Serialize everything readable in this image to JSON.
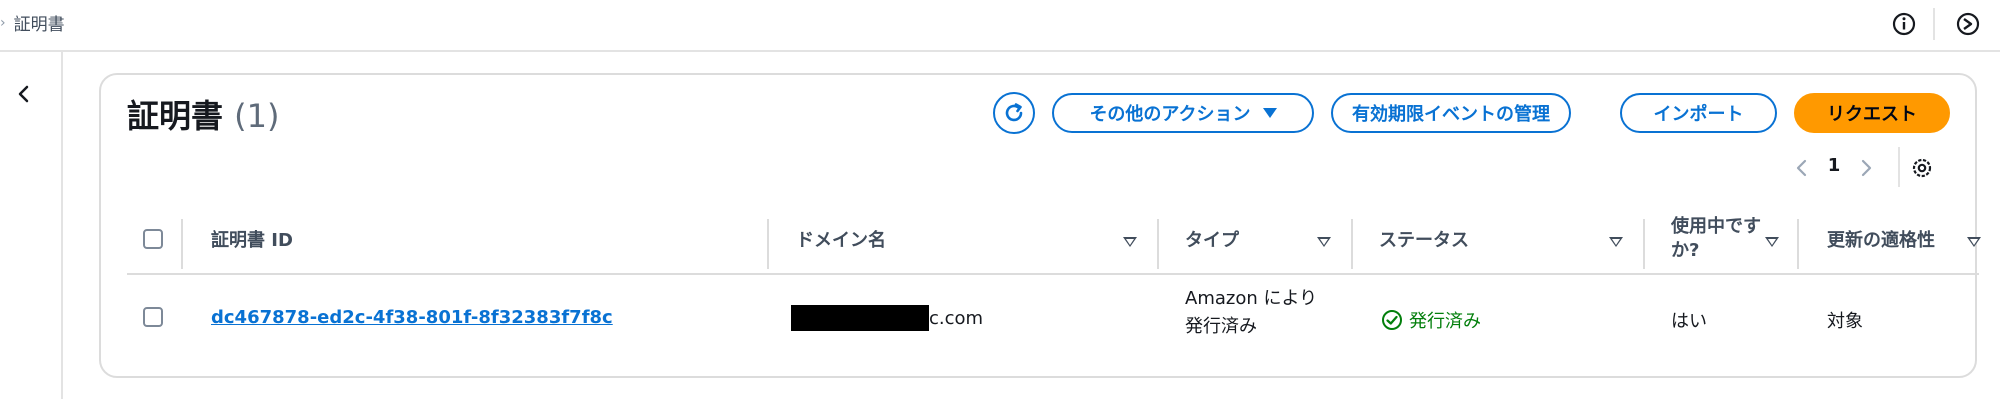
{
  "breadcrumb": {
    "current": "証明書"
  },
  "header": {
    "title": "証明書",
    "count": "(1)"
  },
  "actions": {
    "refresh_icon": "refresh-icon",
    "more_actions": "その他のアクション",
    "expiry_events": "有効期限イベントの管理",
    "import": "インポート",
    "request": "リクエスト"
  },
  "pagination": {
    "current_page": "1"
  },
  "table": {
    "columns": [
      "証明書 ID",
      "ドメイン名",
      "タイプ",
      "ステータス",
      "使用中ですか?",
      "更新の適格性"
    ],
    "rows": [
      {
        "certificate_id": "dc467878-ed2c-4f38-801f-8f32383f7f8c",
        "domain_suffix": "c.com",
        "type_line1": "Amazon により",
        "type_line2": "発行済み",
        "status": "発行済み",
        "in_use": "はい",
        "renewal_eligibility": "対象"
      }
    ]
  },
  "colors": {
    "accent": "#0972d3",
    "primary": "#ff9900",
    "success": "#037f0c"
  }
}
